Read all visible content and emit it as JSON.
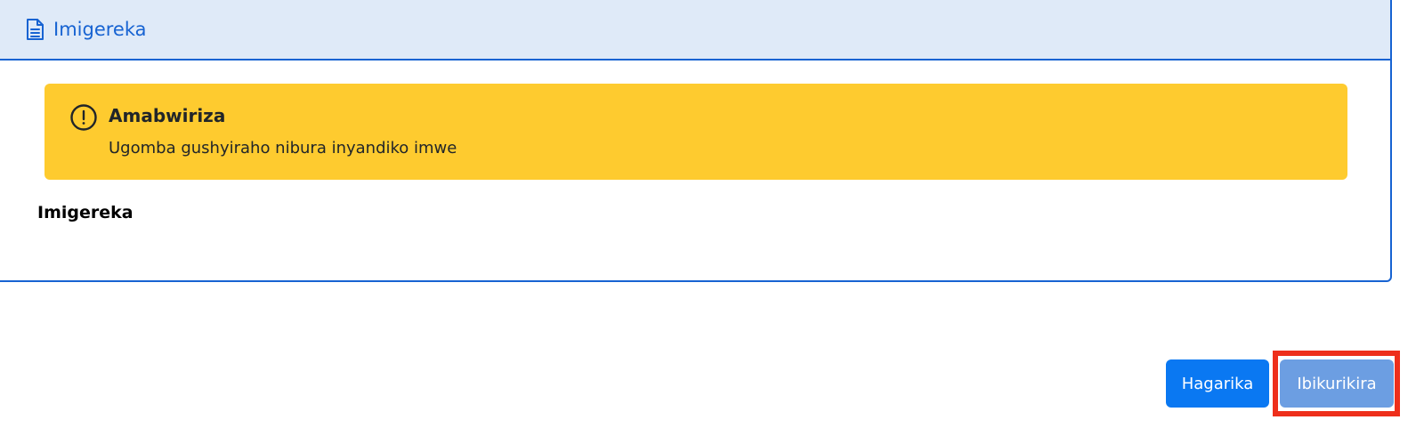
{
  "card": {
    "header_title": "Imigereka",
    "header_icon": "document-icon"
  },
  "alert": {
    "icon": "exclamation-circle-icon",
    "title": "Amabwiriza",
    "text": "Ugomba gushyiraho nibura inyandiko imwe",
    "background": "#fecb2f"
  },
  "section": {
    "label": "Imigereka"
  },
  "actions": {
    "cancel_label": "Hagarika",
    "submit_label": "Ibikurikira"
  },
  "colors": {
    "accent": "#1763d2",
    "header_bg": "#dfeaf8",
    "primary_button": "#0a78f2",
    "disabled_button": "#6c9ee2",
    "highlight": "#ee2f1b"
  }
}
